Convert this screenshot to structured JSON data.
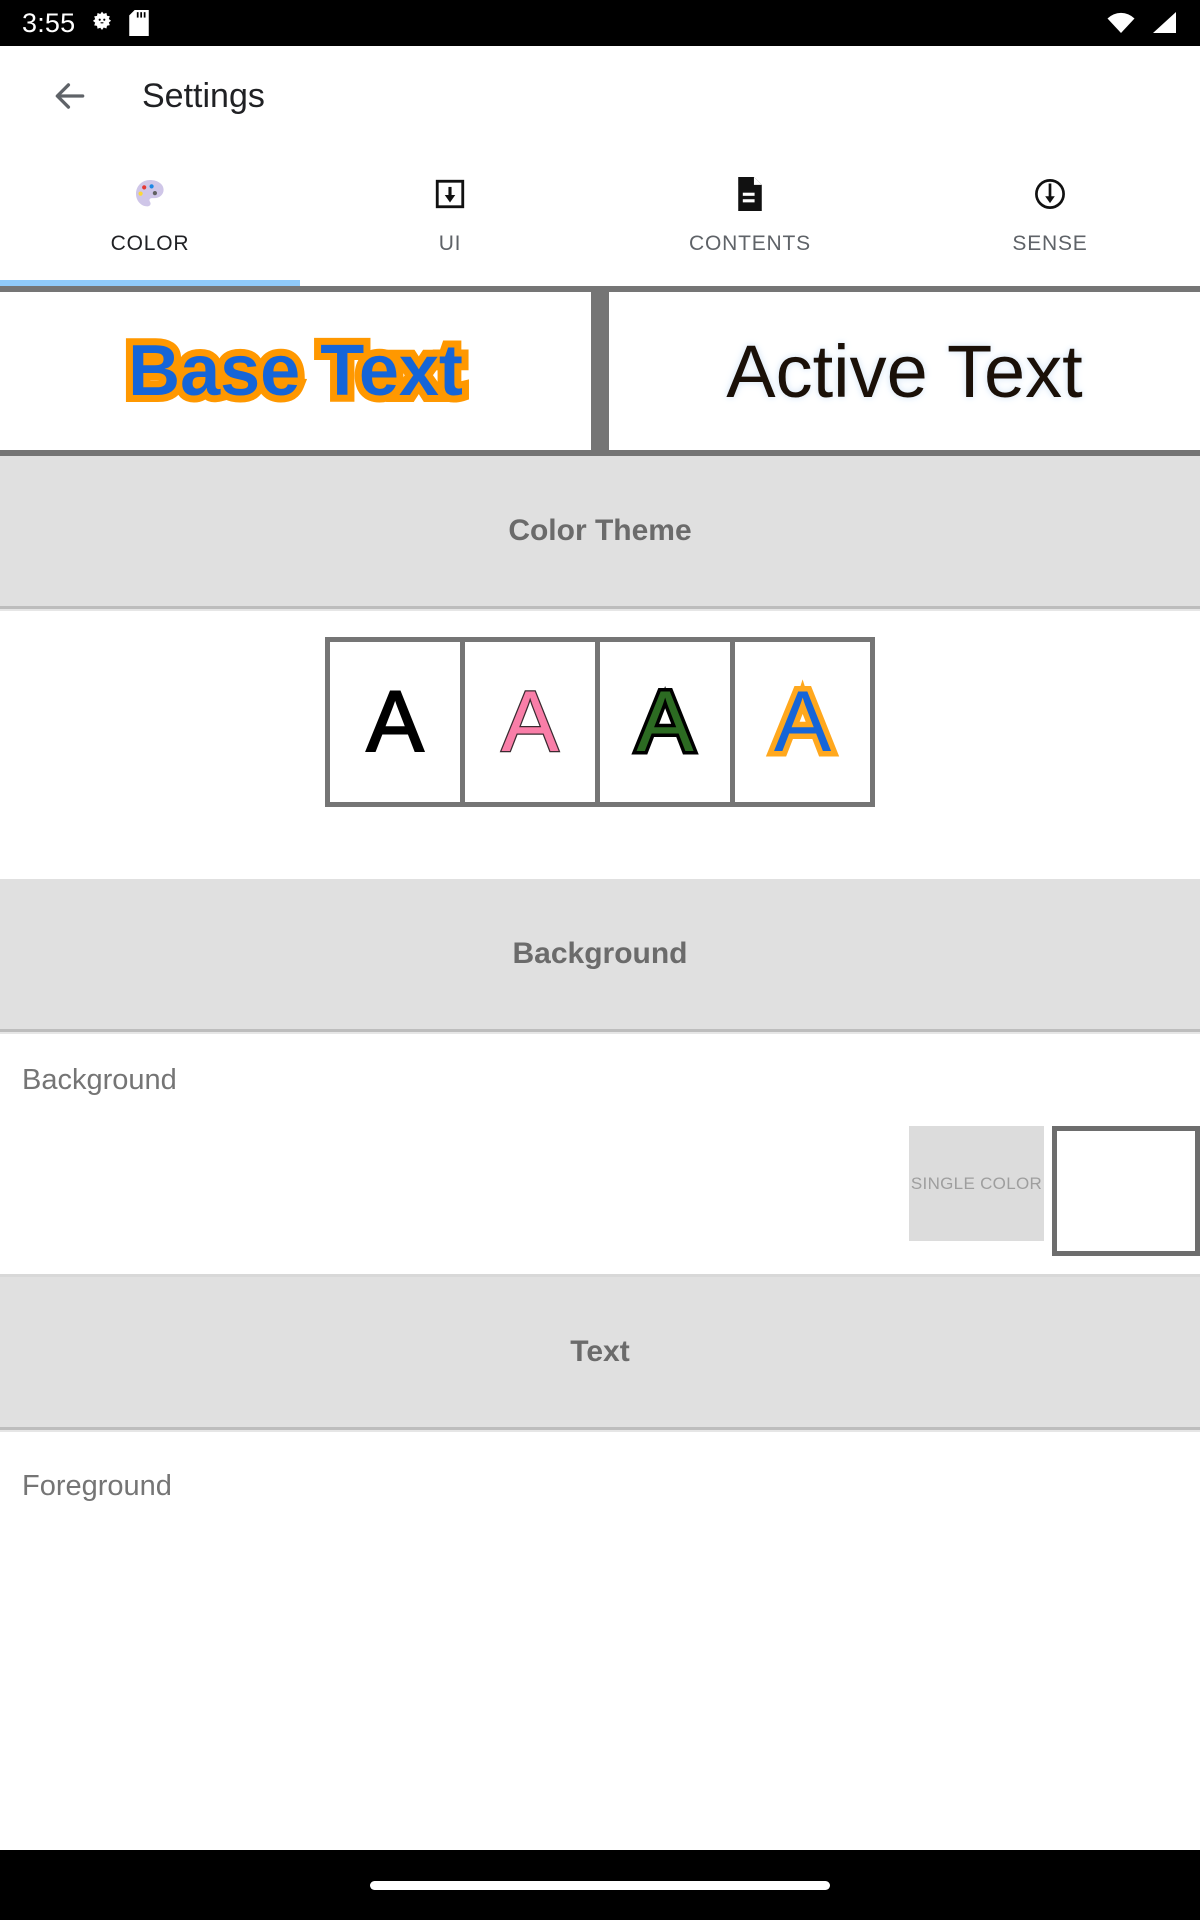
{
  "status_bar": {
    "clock": "3:55",
    "icons_left": [
      "android-gear-icon",
      "sd-card-icon"
    ],
    "icons_right": [
      "wifi-icon",
      "cellular-signal-icon"
    ]
  },
  "app_bar": {
    "back_icon": "arrow-left-icon",
    "title": "Settings"
  },
  "tabs": {
    "active_index": 0,
    "indicator_color": "#90caf9",
    "items": [
      {
        "label": "COLOR",
        "icon": "palette-icon"
      },
      {
        "label": "UI",
        "icon": "download-box-icon"
      },
      {
        "label": "CONTENTS",
        "icon": "document-icon"
      },
      {
        "label": "SENSE",
        "icon": "circle-down-arrow-icon"
      }
    ]
  },
  "preview": {
    "base": {
      "text": "Base Text",
      "fill_color": "#1565d8",
      "stroke_color": "#FF9800"
    },
    "active": {
      "text": "Active Text",
      "fill_color": "#1a1008",
      "glow_color": "#dbe9f7"
    },
    "border_color": "#757575"
  },
  "sections": {
    "color_theme": {
      "title": "Color Theme",
      "swatches": [
        {
          "letter": "A",
          "fill": "#000000",
          "stroke": "#000000",
          "name": "theme-black"
        },
        {
          "letter": "A",
          "fill": "#f97ea8",
          "stroke": "#3a2a30",
          "name": "theme-pink"
        },
        {
          "letter": "A",
          "fill": "#2c6b22",
          "stroke": "#000000",
          "name": "theme-green"
        },
        {
          "letter": "A",
          "fill": "#1565d8",
          "stroke": "#FFA81E",
          "name": "theme-blue-orange"
        }
      ],
      "selected_index": 3
    },
    "background": {
      "title": "Background",
      "row_label": "Background",
      "single_color_label": "SINGLE COLOR",
      "swatch_color": "#ffffff"
    },
    "text": {
      "title": "Text",
      "row_label": "Foreground"
    }
  },
  "nav_bar": {
    "gesture_pill": "home-gesture-pill"
  }
}
